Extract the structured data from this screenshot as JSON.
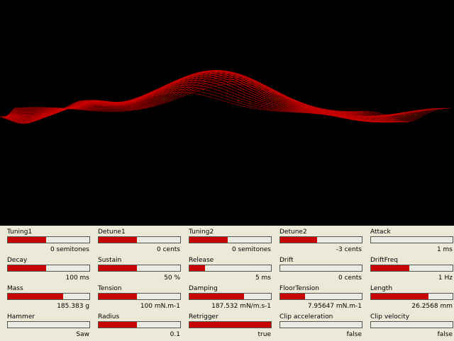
{
  "accent_color": "#c80000",
  "params": [
    [
      {
        "label": "Tuning1",
        "value": "0 semitones",
        "level": 0.47
      },
      {
        "label": "Detune1",
        "value": "0 cents",
        "level": 0.47
      },
      {
        "label": "Tuning2",
        "value": "0 semitones",
        "level": 0.47
      },
      {
        "label": "Detune2",
        "value": "-3 cents",
        "level": 0.45
      },
      {
        "label": "Attack",
        "value": "1 ms",
        "level": 0
      }
    ],
    [
      {
        "label": "Decay",
        "value": "100 ms",
        "level": 0.47
      },
      {
        "label": "Sustain",
        "value": "50 %",
        "level": 0.47
      },
      {
        "label": "Release",
        "value": "5 ms",
        "level": 0.19
      },
      {
        "label": "Drift",
        "value": "0 cents",
        "level": 0
      },
      {
        "label": "DriftFreq",
        "value": "1 Hz",
        "level": 0.47
      }
    ],
    [
      {
        "label": "Mass",
        "value": "185.383 g",
        "level": 0.68
      },
      {
        "label": "Tension",
        "value": "100 mN.m-1",
        "level": 0.47
      },
      {
        "label": "Damping",
        "value": "187.532 mN/m.s-1",
        "level": 0.67
      },
      {
        "label": "FloorTension",
        "value": "7.95647 mN.m-1",
        "level": 0.3
      },
      {
        "label": "Length",
        "value": "26.2568 mm",
        "level": 0.7
      }
    ],
    [
      {
        "label": "Hammer",
        "value": "Saw",
        "level": 0
      },
      {
        "label": "Radius",
        "value": "0.1",
        "level": 0.47
      },
      {
        "label": "Retrigger",
        "value": "true",
        "level": 1
      },
      {
        "label": "Clip acceleration",
        "value": "false",
        "level": 0
      },
      {
        "label": "Clip velocity",
        "value": "false",
        "level": 0
      }
    ]
  ]
}
